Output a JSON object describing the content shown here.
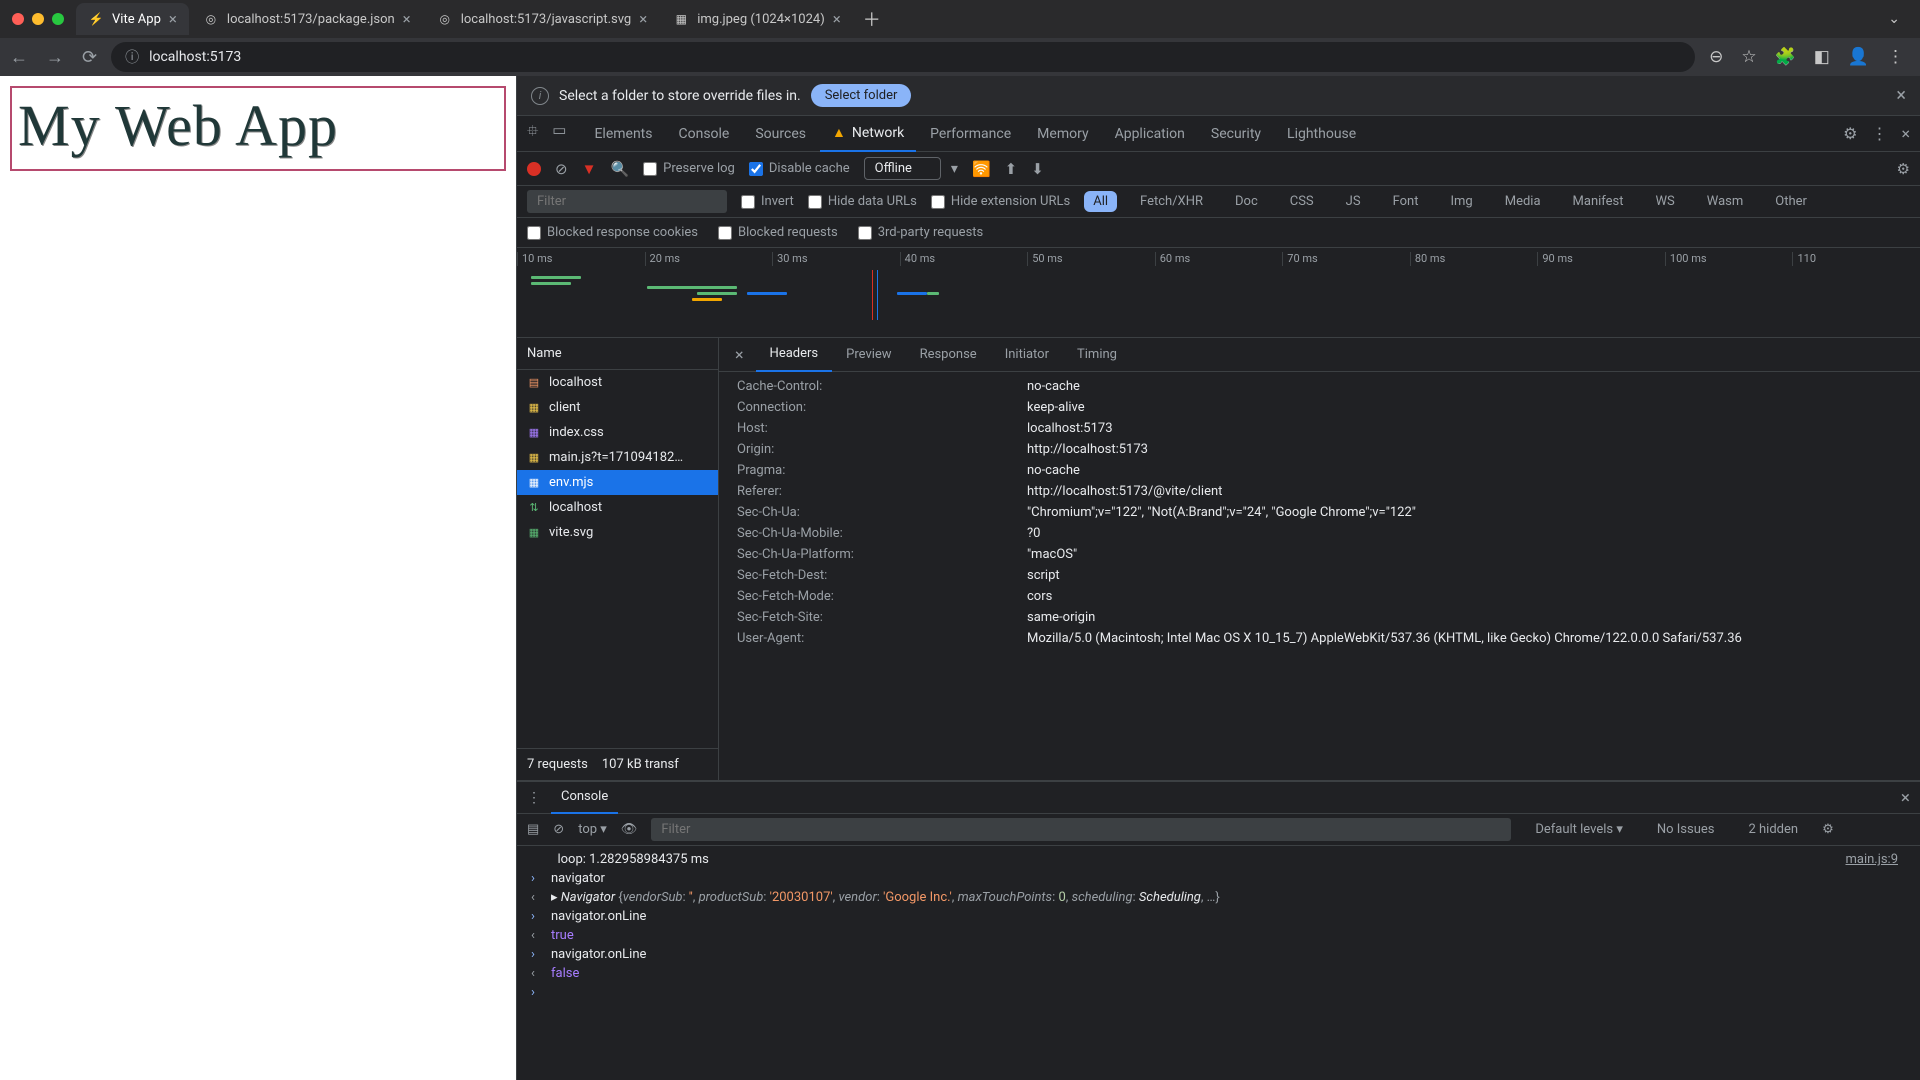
{
  "browser": {
    "tabs": [
      {
        "title": "Vite App",
        "active": true
      },
      {
        "title": "localhost:5173/package.json",
        "active": false
      },
      {
        "title": "localhost:5173/javascript.svg",
        "active": false
      },
      {
        "title": "img.jpeg (1024×1024)",
        "active": false
      }
    ],
    "url": "localhost:5173"
  },
  "page": {
    "h1": "My Web App"
  },
  "override_bar": {
    "message": "Select a folder to store override files in.",
    "button": "Select folder"
  },
  "devtools_tabs": [
    "Elements",
    "Console",
    "Sources",
    "Network",
    "Performance",
    "Memory",
    "Application",
    "Security",
    "Lighthouse"
  ],
  "devtools_active": "Network",
  "net_toolbar": {
    "preserve_log": "Preserve log",
    "disable_cache": "Disable cache",
    "throttle": "Offline"
  },
  "filter_row": {
    "placeholder": "Filter",
    "invert": "Invert",
    "hide_data": "Hide data URLs",
    "hide_ext": "Hide extension URLs",
    "types": [
      "All",
      "Fetch/XHR",
      "Doc",
      "CSS",
      "JS",
      "Font",
      "Img",
      "Media",
      "Manifest",
      "WS",
      "Wasm",
      "Other"
    ],
    "active_type": "All"
  },
  "filter_row2": {
    "blocked_resp": "Blocked response cookies",
    "blocked_req": "Blocked requests",
    "third_party": "3rd-party requests"
  },
  "timeline_ticks": [
    "10 ms",
    "20 ms",
    "30 ms",
    "40 ms",
    "50 ms",
    "60 ms",
    "70 ms",
    "80 ms",
    "90 ms",
    "100 ms",
    "110"
  ],
  "requests": {
    "header": "Name",
    "list": [
      {
        "name": "localhost",
        "type": "doc",
        "icon": "doc"
      },
      {
        "name": "client",
        "type": "script",
        "icon": "js"
      },
      {
        "name": "index.css",
        "type": "stylesheet",
        "icon": "css"
      },
      {
        "name": "main.js?t=171094182…",
        "type": "script",
        "icon": "js"
      },
      {
        "name": "env.mjs",
        "type": "script",
        "icon": "js",
        "selected": true
      },
      {
        "name": "localhost",
        "type": "websocket",
        "icon": "ws"
      },
      {
        "name": "vite.svg",
        "type": "image",
        "icon": "img"
      }
    ],
    "status_count": "7 requests",
    "status_transfer": "107 kB transf"
  },
  "detail": {
    "tabs": [
      "Headers",
      "Preview",
      "Response",
      "Initiator",
      "Timing"
    ],
    "active": "Headers",
    "headers": [
      {
        "name": "Cache-Control:",
        "value": "no-cache"
      },
      {
        "name": "Connection:",
        "value": "keep-alive"
      },
      {
        "name": "Host:",
        "value": "localhost:5173"
      },
      {
        "name": "Origin:",
        "value": "http://localhost:5173"
      },
      {
        "name": "Pragma:",
        "value": "no-cache"
      },
      {
        "name": "Referer:",
        "value": "http://localhost:5173/@vite/client"
      },
      {
        "name": "Sec-Ch-Ua:",
        "value": "\"Chromium\";v=\"122\", \"Not(A:Brand\";v=\"24\", \"Google Chrome\";v=\"122\""
      },
      {
        "name": "Sec-Ch-Ua-Mobile:",
        "value": "?0"
      },
      {
        "name": "Sec-Ch-Ua-Platform:",
        "value": "\"macOS\""
      },
      {
        "name": "Sec-Fetch-Dest:",
        "value": "script"
      },
      {
        "name": "Sec-Fetch-Mode:",
        "value": "cors"
      },
      {
        "name": "Sec-Fetch-Site:",
        "value": "same-origin"
      },
      {
        "name": "User-Agent:",
        "value": "Mozilla/5.0 (Macintosh; Intel Mac OS X 10_15_7) AppleWebKit/537.36 (KHTML, like Gecko) Chrome/122.0.0.0 Safari/537.36"
      }
    ]
  },
  "console": {
    "tab": "Console",
    "context": "top",
    "filter_placeholder": "Filter",
    "levels": "Default levels",
    "issues": "No Issues",
    "hidden": "2 hidden",
    "lines": [
      {
        "kind": "log",
        "text": "loop: 1.282958984375 ms",
        "source": "main.js:9"
      },
      {
        "kind": "in",
        "text": "navigator"
      },
      {
        "kind": "out_obj",
        "cls": "Navigator",
        "body": "{vendorSub: '', productSub: '20030107', vendor: 'Google Inc.', maxTouchPoints: 0, scheduling: Scheduling, …}"
      },
      {
        "kind": "in",
        "text": "navigator.onLine"
      },
      {
        "kind": "out_bool",
        "text": "true"
      },
      {
        "kind": "in",
        "text": "navigator.onLine"
      },
      {
        "kind": "out_bool",
        "text": "false"
      }
    ]
  }
}
